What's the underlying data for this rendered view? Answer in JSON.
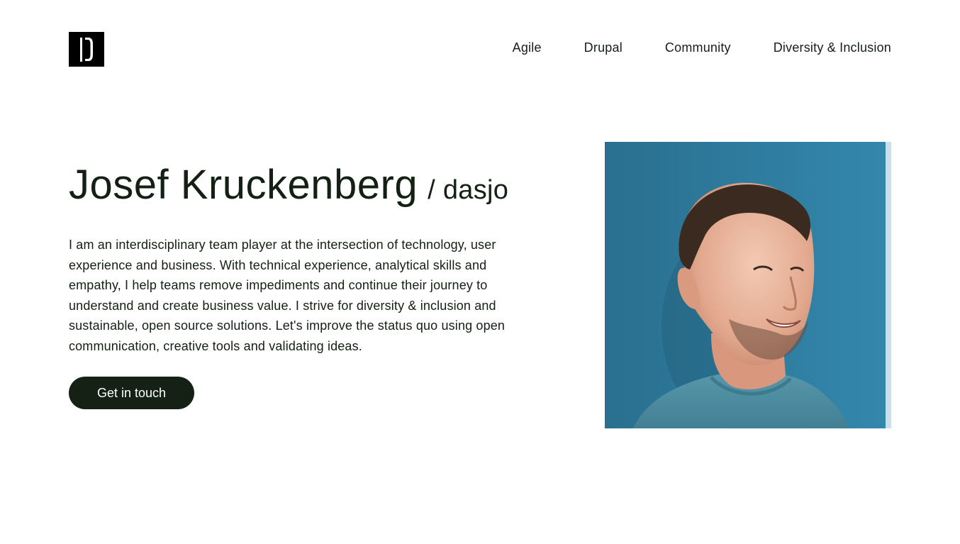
{
  "header": {
    "logo_icon": "dasjo-logo-icon",
    "nav": [
      {
        "label": "Agile"
      },
      {
        "label": "Drupal"
      },
      {
        "label": "Community"
      },
      {
        "label": "Diversity & Inclusion"
      }
    ]
  },
  "hero": {
    "name": "Josef Kruckenberg",
    "handle": "/ dasjo",
    "intro": "I am an interdisciplinary team player at the intersection of technology, user experience and business. With technical experience, analytical skills and empathy, I help teams remove impediments and continue their journey to understand and create business value. I strive for diversity & inclusion and sustainable, open source solutions. Let's improve the status quo using open communication, creative tools and validating ideas.",
    "cta_label": "Get in touch",
    "portrait_icon": "portrait-photo"
  },
  "colors": {
    "text": "#132013",
    "button_bg": "#142114",
    "button_text": "#ffffff",
    "photo_bg": "#2e7a9c"
  }
}
